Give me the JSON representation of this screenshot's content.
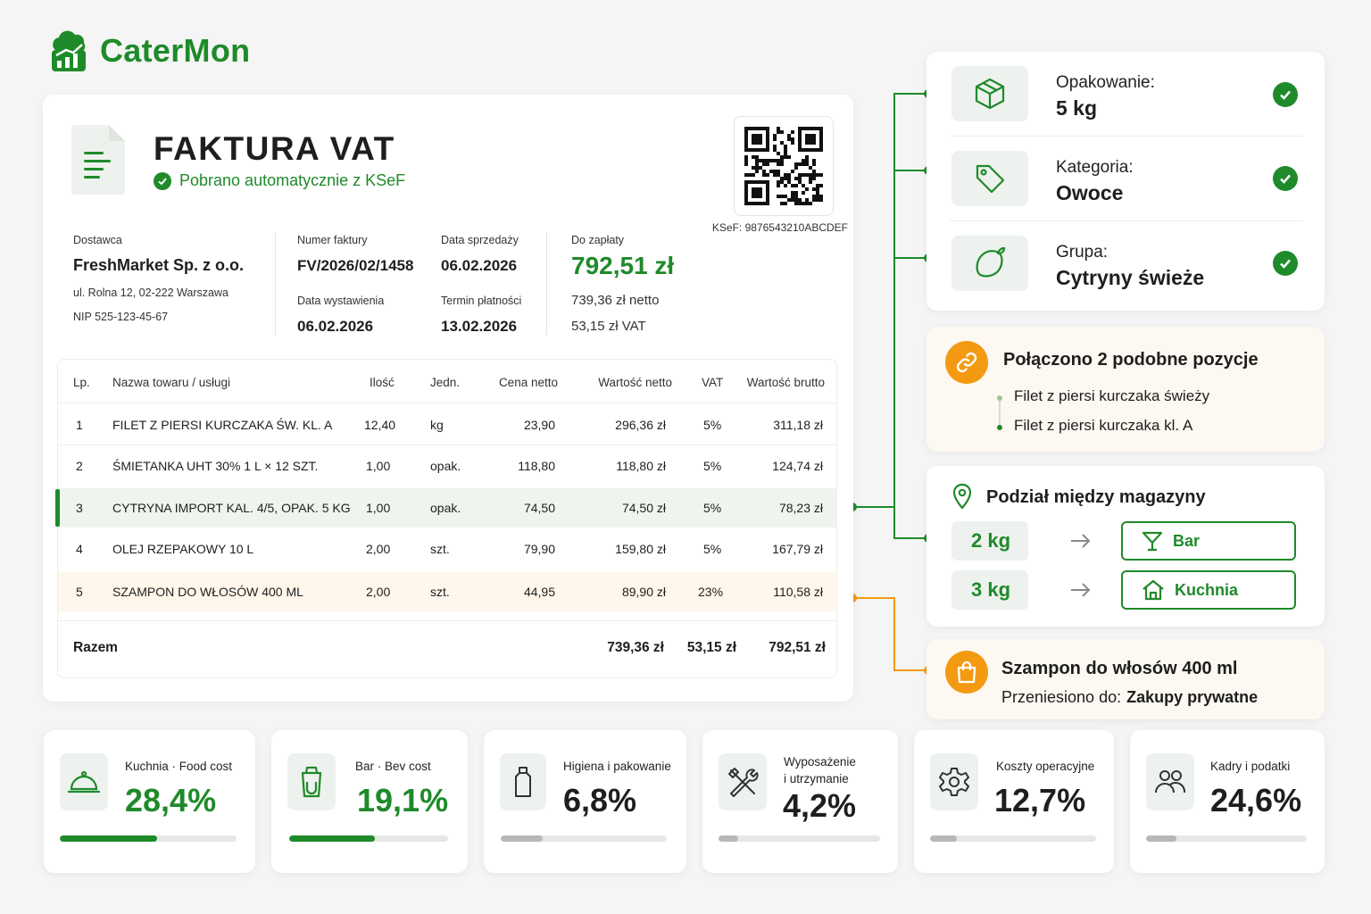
{
  "brand": {
    "name": "CaterMon",
    "accent": "#1f8a2a",
    "warn": "#f39a12"
  },
  "invoice": {
    "title": "FAKTURA VAT",
    "subtitle": "Pobrano automatycznie z KSeF",
    "ksef_id": "KSeF: 9876543210ABCDEF",
    "supplier": {
      "label": "Dostawca",
      "name": "FreshMarket Sp. z o.o.",
      "address": "ul. Rolna 12, 02-222 Warszawa",
      "nip": "NIP 525-123-45-67"
    },
    "invoice_number": {
      "label": "Numer faktury",
      "value": "FV/2026/02/1458"
    },
    "sale_date": {
      "label": "Data sprzedaży",
      "value": "06.02.2026"
    },
    "issue_date": {
      "label": "Data wystawienia",
      "value": "06.02.2026"
    },
    "due_date": {
      "label": "Termin płatności",
      "value": "13.02.2026"
    },
    "payment": {
      "label": "Do zapłaty",
      "total": "792,51 zł",
      "net": "739,36 zł netto",
      "vat": "53,15 zł VAT"
    }
  },
  "table": {
    "headers": [
      "Lp.",
      "Nazwa towaru / usługi",
      "Ilość",
      "Jedn.",
      "Cena netto",
      "Wartość netto",
      "VAT",
      "Wartość brutto"
    ],
    "rows": [
      [
        "1",
        "FILET Z PIERSI KURCZAKA ŚW. KL. A",
        "12,40",
        "kg",
        "23,90",
        "296,36 zł",
        "5%",
        "311,18 zł"
      ],
      [
        "2",
        "ŚMIETANKA UHT 30% 1 L × 12 SZT.",
        "1,00",
        "opak.",
        "118,80",
        "118,80 zł",
        "5%",
        "124,74 zł"
      ],
      [
        "3",
        "CYTRYNA IMPORT KAL. 4/5, OPAK. 5 KG",
        "1,00",
        "opak.",
        "74,50",
        "74,50 zł",
        "5%",
        "78,23 zł"
      ],
      [
        "4",
        "OLEJ RZEPAKOWY 10 L",
        "2,00",
        "szt.",
        "79,90",
        "159,80 zł",
        "5%",
        "167,79 zł"
      ],
      [
        "5",
        "SZAMPON DO WŁOSÓW 400 ML",
        "2,00",
        "szt.",
        "44,95",
        "89,90 zł",
        "23%",
        "110,58 zł"
      ]
    ],
    "total": {
      "label": "Razem",
      "net": "739,36 zł",
      "vat": "53,15 zł",
      "gross": "792,51 zł"
    }
  },
  "attributes": [
    {
      "label": "Opakowanie:",
      "value": "5 kg",
      "icon": "box-icon"
    },
    {
      "label": "Kategoria:",
      "value": "Owoce",
      "icon": "tag-icon"
    },
    {
      "label": "Grupa:",
      "value": "Cytryny świeże",
      "icon": "lemon-icon"
    }
  ],
  "merge": {
    "title": "Połączono 2 podobne pozycje",
    "items": [
      "Filet z piersi kurczaka świeży",
      "Filet z piersi kurczaka kl. A"
    ]
  },
  "split": {
    "title": "Podział między magazyny",
    "rows": [
      {
        "qty": "2 kg",
        "target": "Bar"
      },
      {
        "qty": "3 kg",
        "target": "Kuchnia"
      }
    ]
  },
  "moved": {
    "title": "Szampon do włosów 400 ml",
    "prefix": "Przeniesiono do:",
    "target": "Zakupy prywatne"
  },
  "kpis": [
    {
      "label": "Kuchnia · Food cost",
      "value": "28,4%",
      "level": 0.55,
      "highlight": true
    },
    {
      "label": "Bar · Bev cost",
      "value": "19,1%",
      "level": 0.54,
      "highlight": true
    },
    {
      "label": "Higiena i pakowanie",
      "value": "6,8%",
      "level": 0.25,
      "highlight": false
    },
    {
      "label": "Wyposażenie\ni utrzymanie",
      "value": "4,2%",
      "level": 0.12,
      "highlight": false
    },
    {
      "label": "Koszty operacyjne",
      "value": "12,7%",
      "level": 0.16,
      "highlight": false
    },
    {
      "label": "Kadry i podatki",
      "value": "24,6%",
      "level": 0.19,
      "highlight": false
    }
  ]
}
